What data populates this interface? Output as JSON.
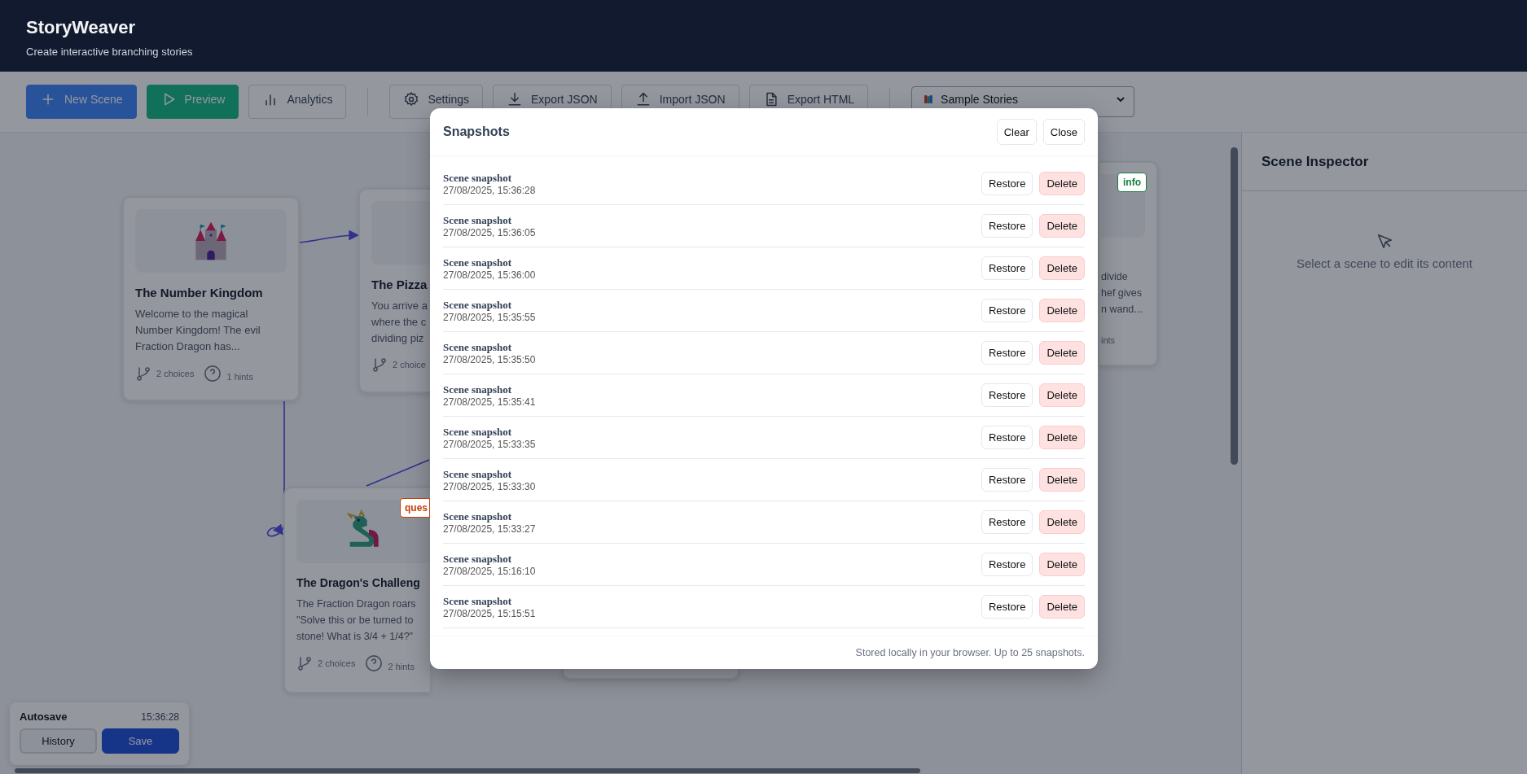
{
  "header": {
    "title": "StoryWeaver",
    "subtitle": "Create interactive branching stories"
  },
  "toolbar": {
    "buttons": [
      {
        "label": "New Scene",
        "kind": "primary"
      },
      {
        "label": "Preview",
        "kind": "success"
      },
      {
        "label": "Analytics",
        "kind": "outline"
      },
      {
        "label": "Settings",
        "kind": "outline"
      },
      {
        "label": "Export JSON",
        "kind": "outline"
      },
      {
        "label": "Import JSON",
        "kind": "outline"
      },
      {
        "label": "Export HTML",
        "kind": "outline"
      }
    ],
    "story_select": {
      "value": "Sample Stories"
    }
  },
  "scenes": [
    {
      "title": "The Number Kingdom",
      "excerpt_lines": [
        "Welcome to the magical",
        "Number Kingdom! The evil",
        "Fraction Dragon has..."
      ],
      "choices": "2 choices",
      "hints": "1 hints"
    },
    {
      "title": "The Pizza",
      "excerpt_lines": [
        "You arrive a",
        "where the c",
        "dividing piz"
      ],
      "choices": "2 choice"
    },
    {
      "title": "The Dragon's Challeng",
      "excerpt_lines": [
        "The Fraction Dragon roars",
        "\"Solve this or be turned to",
        "stone! What is 3/4 + 1/4?\""
      ],
      "choices": "2 choices",
      "hints": "2 hints",
      "tag": {
        "label": "ques",
        "color": "#c2410c"
      }
    },
    {
      "excerpt_lines": [
        "divide",
        "hef gives",
        "n wand..."
      ],
      "hints": "ints",
      "tag": {
        "label": "info",
        "color": "#15803d"
      }
    }
  ],
  "inspector": {
    "title": "Scene Inspector",
    "empty_message": "Select a scene to edit its content"
  },
  "autosave": {
    "label": "Autosave",
    "time": "15:36:28",
    "buttons": [
      {
        "label": "History",
        "kind": "outline"
      },
      {
        "label": "Save",
        "kind": "primary"
      }
    ]
  },
  "snapshots_dialog": {
    "title": "Snapshots",
    "actions": [
      "Clear",
      "Close"
    ],
    "snapshots": [
      {
        "title": "Scene snapshot",
        "time": "27/08/2025, 15:36:28",
        "actions": [
          "Restore",
          "Delete"
        ]
      },
      {
        "title": "Scene snapshot",
        "time": "27/08/2025, 15:36:05",
        "actions": [
          "Restore",
          "Delete"
        ]
      },
      {
        "title": "Scene snapshot",
        "time": "27/08/2025, 15:36:00",
        "actions": [
          "Restore",
          "Delete"
        ]
      },
      {
        "title": "Scene snapshot",
        "time": "27/08/2025, 15:35:55",
        "actions": [
          "Restore",
          "Delete"
        ]
      },
      {
        "title": "Scene snapshot",
        "time": "27/08/2025, 15:35:50",
        "actions": [
          "Restore",
          "Delete"
        ]
      },
      {
        "title": "Scene snapshot",
        "time": "27/08/2025, 15:35:41",
        "actions": [
          "Restore",
          "Delete"
        ]
      },
      {
        "title": "Scene snapshot",
        "time": "27/08/2025, 15:33:35",
        "actions": [
          "Restore",
          "Delete"
        ]
      },
      {
        "title": "Scene snapshot",
        "time": "27/08/2025, 15:33:30",
        "actions": [
          "Restore",
          "Delete"
        ]
      },
      {
        "title": "Scene snapshot",
        "time": "27/08/2025, 15:33:27",
        "actions": [
          "Restore",
          "Delete"
        ]
      },
      {
        "title": "Scene snapshot",
        "time": "27/08/2025, 15:16:10",
        "actions": [
          "Restore",
          "Delete"
        ]
      },
      {
        "title": "Scene snapshot",
        "time": "27/08/2025, 15:15:51",
        "actions": [
          "Restore",
          "Delete"
        ]
      }
    ],
    "footer": "Stored locally in your browser. Up to 25 snapshots."
  }
}
